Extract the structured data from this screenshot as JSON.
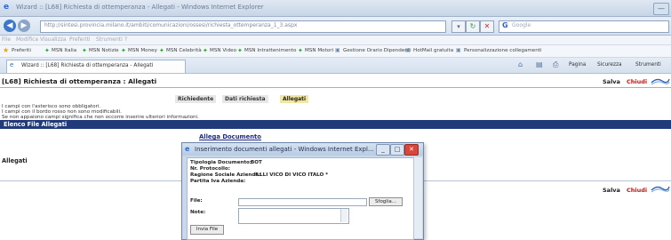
{
  "browser": {
    "window_title": "Wizard :: [L68] Richiesta di ottemperanza - Allegati - Windows Internet Explorer",
    "address": "http://sintesi.provincia.milano.it/ambiti/comunicazioni/ossesi/richiesta_ottemperanza_1_3.aspx",
    "search_placeholder": "Google",
    "menu": [
      "File",
      "Modifica",
      "Visualizza",
      "Preferiti",
      "Strumenti",
      "?"
    ],
    "favorites_label": "Preferiti",
    "favorites": [
      "MSN Italia",
      "MSN Notizie",
      "MSN Money",
      "MSN Celebrità",
      "MSN Video",
      "MSN Intrattenimento",
      "MSN Motori",
      "Gestione Orario Dipendenti",
      "HotMail gratuita",
      "Personalizzazione collegamenti"
    ],
    "tab_label": "Wizard :: [L68] Richiesta di ottemperanza - Allegati",
    "commands": [
      "Pagina",
      "Sicurezza",
      "Strumenti"
    ]
  },
  "page": {
    "title": "[L68] Richiesta di ottemperanza : Allegati",
    "salva": "Salva",
    "chiudi": "Chiudi",
    "tabs": [
      "Richiedente",
      "Dati richiesta",
      "Allegati"
    ],
    "info": [
      "I campi con l'asterisco sono obbligatori.",
      "I campi con il bordo rosso non sono modificabili.",
      "Se non appaiono campi significa che non occorre inserire ulteriori informazioni."
    ],
    "section_header": "Elenco File Allegati",
    "allega_link": "Allega Documento",
    "allegati_label": "Allegati"
  },
  "dialog": {
    "title": "Inserimento documenti allegati - Windows Internet Expl...",
    "tipologia_label": "Tipologia Documento:",
    "tipologia_value": "BOT",
    "protocollo_label": "Nr. Protocollo:",
    "ragione_label": "Ragione Sociale Azienda:",
    "ragione_value": "F.LLI VICO DI VICO ITALO *",
    "piva_label": "Partita Iva Azienda:",
    "file_label": "File:",
    "sfoglia": "Sfoglia...",
    "note_label": "Note:",
    "invia": "Invia File"
  }
}
